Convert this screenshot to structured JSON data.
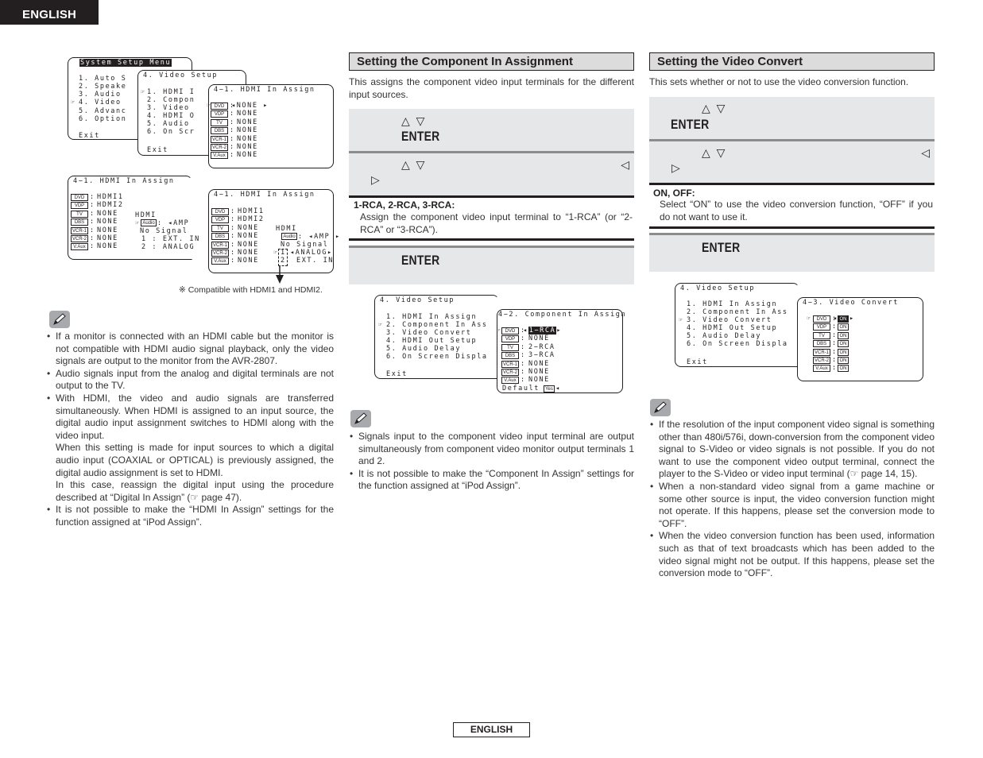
{
  "header": {
    "language_tab": "ENGLISH"
  },
  "footer": {
    "language_label": "ENGLISH"
  },
  "icons": {
    "up_down": "△ ▽",
    "left": "◁",
    "right": "▷",
    "cursor": "☞",
    "ref": "☞",
    "note": "pencil-icon"
  },
  "left": {
    "screens": {
      "system_menu": {
        "title": "System Setup Menu",
        "items": [
          "1. Auto S",
          "2. Speake",
          "3. Audio",
          "4. Video",
          "5. Advanc",
          "6. Option"
        ],
        "exit": "Exit",
        "selected_index": 3
      },
      "video_setup": {
        "title": "4. Video Setup",
        "items": [
          "1. HDMI I",
          "2. Compon",
          "3. Video",
          "4. HDMI O",
          "5. Audio",
          "6. On Scr"
        ],
        "exit": "Exit",
        "selected_index": 0
      },
      "hdmi_assign_1": {
        "title": "4−1. HDMI In Assign",
        "sources": [
          "DVD",
          "VDP",
          "TV",
          "DBS",
          "VCR-1",
          "VCR-2",
          "V.Aux"
        ],
        "values": [
          "NONE",
          "NONE",
          "NONE",
          "NONE",
          "NONE",
          "NONE",
          "NONE"
        ]
      },
      "hdmi_assign_2": {
        "title": "4−1. HDMI In Assign",
        "sources": [
          "DVD",
          "VDP",
          "TV",
          "DBS",
          "VCR-1",
          "VCR-2",
          "V.Aux"
        ],
        "values": [
          "HDMI1",
          "HDMI2",
          "NONE",
          "NONE",
          "NONE",
          "NONE",
          "NONE"
        ],
        "sub_title": "HDMI",
        "audio_label": "Audio",
        "audio_value": "AMP",
        "signal": "No Signal",
        "line1": "1 :  EXT. IN",
        "line2": "2 :  ANALOG"
      },
      "hdmi_assign_3": {
        "title": "4−1. HDMI In Assign",
        "sources": [
          "DVD",
          "VDP",
          "TV",
          "DBS",
          "VCR-1",
          "VCR-2",
          "V.Aux"
        ],
        "values": [
          "HDMI1",
          "HDMI2",
          "NONE",
          "NONE",
          "NONE",
          "NONE",
          "NONE"
        ],
        "sub_title": "HDMI",
        "audio_label": "Audio",
        "audio_value": "AMP",
        "signal": "No Signal",
        "n1": "1",
        "n2": "2",
        "v1": "ANALOG",
        "v2": "EXT. IN"
      }
    },
    "caption": "※  Compatible with HDMI1 and HDMI2.",
    "notes": [
      "If a monitor is connected with an HDMI cable but the monitor is not compatible with HDMI audio signal playback, only the video signals are output to the monitor from the AVR-2807.",
      "Audio signals input from the analog and digital terminals are not output to the TV."
    ],
    "note3_a": "With HDMI, the video and audio signals are transferred simultaneously. When HDMI is assigned to an input source, the digital audio input assignment switches to HDMI along with the video input.",
    "note3_b": "When this setting is made for input sources to which a digital audio input (COAXIAL or OPTICAL) is previously assigned, the digital audio assignment is set to HDMI.",
    "note3_c1": "In this case, reassign the digital input using the procedure described at “Digital In Assign” (",
    "note3_c2": " page 47).",
    "note4": "It is not possible to make the “HDMI In Assign” settings for the function assigned at “iPod Assign”."
  },
  "middle": {
    "title": "Setting the Component In Assignment",
    "intro": "This assigns the component video input terminals for the different input sources.",
    "step1_enter": "ENTER",
    "step3_enter": "ENTER",
    "option_head": "1-RCA, 2-RCA, 3-RCA:",
    "option_desc": "Assign the component video input terminal to “1-RCA” (or “2-RCA” or “3-RCA”).",
    "screens": {
      "video_setup": {
        "title": "4. Video Setup",
        "items": [
          "1. HDMI In Assign",
          "2. Component In Ass",
          "3. Video Convert",
          "4. HDMI Out Setup",
          "5. Audio Delay",
          "6. On Screen Displa"
        ],
        "exit": "Exit",
        "selected_index": 1
      },
      "component_assign": {
        "title": "4−2. Component In Assign",
        "sources": [
          "DVD",
          "VDP",
          "TV",
          "DBS",
          "VCR-1",
          "VCR-2",
          "V.Aux"
        ],
        "values": [
          "1−RCA",
          "NONE",
          "2−RCA",
          "3−RCA",
          "NONE",
          "NONE",
          "NONE"
        ],
        "default_label": "Default",
        "default_value": "Yes"
      }
    },
    "notes": [
      "Signals input to the component video input terminal are output simultaneously from component video monitor output terminals 1 and 2.",
      "It is not possible to make the “Component In Assign” settings for the function assigned at “iPod Assign”."
    ]
  },
  "right": {
    "title": "Setting the Video Convert",
    "intro": "This sets whether or not to use the video conversion function.",
    "step1_enter": "ENTER",
    "step3_enter": "ENTER",
    "option_head": "ON, OFF:",
    "option_desc": "Select “ON” to use the video conversion function, “OFF” if you do not want to use it.",
    "screens": {
      "video_setup": {
        "title": "4. Video Setup",
        "items": [
          "1. HDMI In Assign",
          "2. Component In Ass",
          "3. Video Convert",
          "4. HDMI Out Setup",
          "5. Audio Delay",
          "6. On Screen Displa"
        ],
        "exit": "Exit",
        "selected_index": 2
      },
      "video_convert": {
        "title": "4−3. Video Convert",
        "sources": [
          "DVD",
          "VDP",
          "TV",
          "DBS",
          "VCR-1",
          "VCR-2",
          "V.Aux"
        ],
        "values": [
          "ON",
          "ON",
          "ON",
          "ON",
          "ON",
          "ON",
          "ON"
        ]
      }
    },
    "note1_a": "If the resolution of the input component video signal is something other than 480i/576i, down-conversion from the component video signal to S-Video or video signals is not possible. If you do not want to use the component video output terminal, connect the player to the S-Video or video input terminal (",
    "note1_b": " page 14, 15).",
    "notes": [
      "When a non-standard video signal from a game machine or some other source is input, the video conversion function might not operate. If this happens, please set the conversion mode to “OFF”.",
      "When the video conversion function has been used, information such as that of text broadcasts which has been added to the video signal might not be output. If this happens, please set the conversion mode to “OFF”."
    ]
  }
}
